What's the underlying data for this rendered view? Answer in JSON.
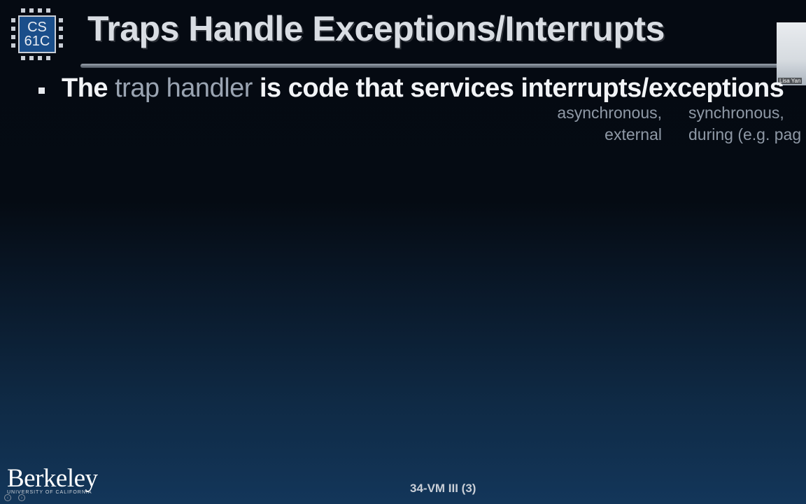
{
  "logo": {
    "line1": "CS",
    "line2": "61C"
  },
  "slide": {
    "title": "Traps Handle Exceptions/Interrupts",
    "bullet": {
      "prefix": "The ",
      "highlight": "trap handler",
      "suffix": " is code that services interrupts/exceptions"
    },
    "annotations": {
      "interrupt": [
        "asynchronous,",
        "external"
      ],
      "exception": [
        "synchronous,",
        "during (e.g. pag"
      ]
    }
  },
  "webcam": {
    "name": "Lisa Yan"
  },
  "footer": {
    "university": "Berkeley",
    "university_sub": "UNIVERSITY OF CALIFORNIA",
    "slide_number": "34-VM III (3)"
  },
  "colors": {
    "title": "#d9dde3",
    "highlight": "#9aa4b2",
    "annotation": "#8f99a6",
    "background_top": "#050a12",
    "background_bottom": "#13365a"
  },
  "icons": {
    "player_prev": "chevron-left-icon",
    "player_next": "chevron-right-icon"
  }
}
